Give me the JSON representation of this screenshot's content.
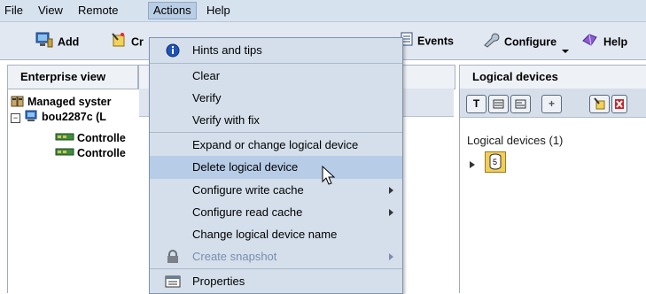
{
  "menubar": {
    "items": [
      {
        "label": "File"
      },
      {
        "label": "View"
      },
      {
        "label": "Remote"
      },
      {
        "label": "Actions"
      },
      {
        "label": "Help"
      }
    ]
  },
  "toolbar": {
    "add_label": "Add",
    "create_label": "Cr",
    "events_label": "Events",
    "configure_label": "Configure",
    "help_label": "Help"
  },
  "left_panel": {
    "title": "Enterprise view",
    "tree": [
      {
        "label": "Managed syster"
      },
      {
        "label": "bou2287c (L"
      },
      {
        "label": "Controlle"
      },
      {
        "label": "Controlle"
      }
    ]
  },
  "right_panel": {
    "title": "Logical devices",
    "tool_buttons": [
      "T",
      "",
      "",
      "+",
      "",
      ""
    ],
    "devices_heading": "Logical devices (1)",
    "device_number": "5"
  },
  "actions_menu": {
    "items": [
      {
        "label": "Hints and tips"
      },
      {
        "label": "Clear"
      },
      {
        "label": "Verify"
      },
      {
        "label": "Verify with fix"
      },
      {
        "label": "Expand or change logical device"
      },
      {
        "label": "Delete logical device"
      },
      {
        "label": "Configure write cache"
      },
      {
        "label": "Configure read cache"
      },
      {
        "label": "Change logical device name"
      },
      {
        "label": "Create snapshot"
      },
      {
        "label": "Properties"
      }
    ],
    "highlighted": "Delete logical device"
  },
  "colors": {
    "menubar_bg": "#d7e2ef",
    "menu_bg": "#d4dfeb",
    "highlight_bg": "#b7cce7",
    "disabled_text": "#7a8db0"
  }
}
